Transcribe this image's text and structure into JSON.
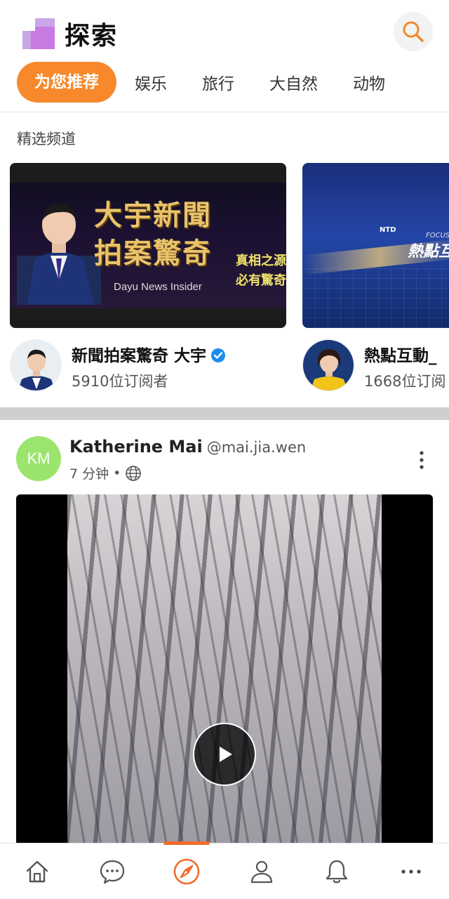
{
  "header": {
    "title": "探索",
    "search_icon": "search-icon"
  },
  "tabs": [
    {
      "label": "为您推荐",
      "active": true
    },
    {
      "label": "娱乐",
      "active": false
    },
    {
      "label": "旅行",
      "active": false
    },
    {
      "label": "大自然",
      "active": false
    },
    {
      "label": "动物",
      "active": false
    }
  ],
  "featured": {
    "label": "精选频道",
    "channels": [
      {
        "name": "新聞拍案驚奇 大宇",
        "subscribers": "5910位订阅者",
        "verified": true,
        "thumb_title_line1": "大宇新聞",
        "thumb_title_line2": "拍案驚奇",
        "thumb_en": "Dayu News Insider",
        "thumb_tag_line1": "真相之源",
        "thumb_tag_line2": "必有驚奇"
      },
      {
        "name": "熱點互動_",
        "subscribers": "1668位订阅",
        "verified": false,
        "thumb_ntd": "NTD",
        "thumb_focus": "FOCUS",
        "thumb_title": "熱點互"
      }
    ]
  },
  "post": {
    "avatar_initials": "KM",
    "author": "Katherine Mai",
    "handle": "@mai.jia.wen",
    "time": "7 分钟",
    "separator": "•",
    "visibility_icon": "globe-icon"
  },
  "bottom_nav": {
    "items": [
      "home-icon",
      "chat-icon",
      "compass-icon",
      "profile-icon",
      "bell-icon",
      "more-icon"
    ],
    "active": "compass-icon"
  },
  "colors": {
    "accent": "#f7892c",
    "active_nav": "#f26b2b",
    "avatar_green": "#9be56e",
    "verified_blue": "#1d8cf0"
  }
}
